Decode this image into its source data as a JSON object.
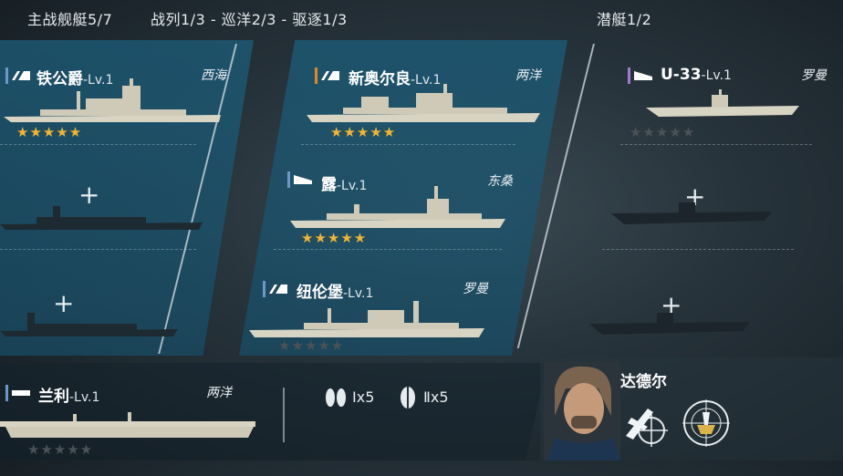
{
  "header": {
    "main_ships": "主战舰艇5/7",
    "composition": "战列1/3 - 巡洋2/3 - 驱逐1/3",
    "submarines": "潜艇1/2"
  },
  "ships": [
    {
      "name": "铁公爵",
      "level": "-Lv.1",
      "region": "西海",
      "stars": "★★★★★",
      "stars_filled": 5,
      "class_color": "#6b98c8"
    },
    {
      "name": "新奥尔良",
      "level": "-Lv.1",
      "region": "两洋",
      "stars": "★★★★★",
      "stars_filled": 5,
      "class_color": "#d88a2e"
    },
    {
      "name": "露",
      "level": "-Lv.1",
      "region": "东桑",
      "stars": "★★★★★",
      "stars_filled": 5,
      "class_color": "#6b98c8"
    },
    {
      "name": "纽伦堡",
      "level": "-Lv.1",
      "region": "罗曼",
      "stars": "★★★★★",
      "stars_filled": 0,
      "class_color": "#6b98c8"
    },
    {
      "name": "U-33",
      "level": "-Lv.1",
      "region": "罗曼",
      "stars": "★★★★★",
      "stars_filled": 0,
      "class_color": "#a07ad0"
    },
    {
      "name": "兰利",
      "level": "-Lv.1",
      "region": "两洋",
      "stars": "★★★★★",
      "stars_filled": 0,
      "class_color": "#6b98c8"
    }
  ],
  "empty_slot": {
    "plus": "+"
  },
  "aircraft": {
    "count1": "Ⅰx5",
    "count2": "Ⅱx5"
  },
  "commander": {
    "name": "达德尔"
  },
  "colors": {
    "panel": "#1c5c78",
    "star": "#f2b431",
    "star_dim": "#4a5257"
  }
}
